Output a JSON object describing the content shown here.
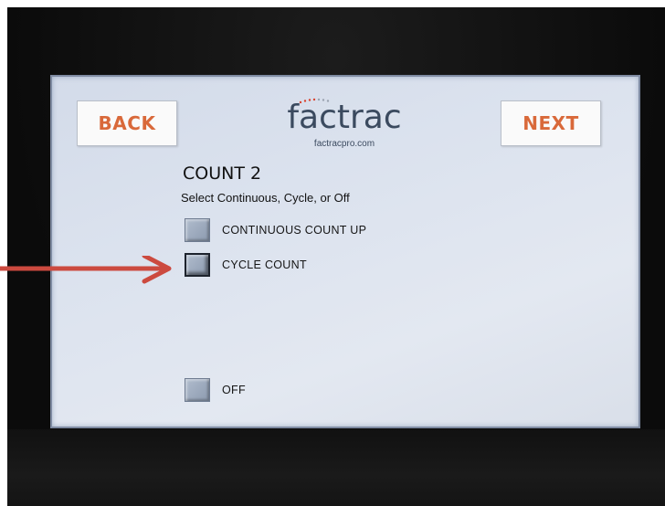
{
  "header": {
    "back_label": "BACK",
    "next_label": "NEXT",
    "logo_text": "factrac",
    "logo_url": "factracpro.com"
  },
  "main": {
    "title": "COUNT 2",
    "subtitle": "Select Continuous, Cycle, or Off",
    "options": [
      {
        "label": "CONTINUOUS COUNT UP",
        "selected": false
      },
      {
        "label": "CYCLE COUNT",
        "selected": true
      },
      {
        "label": "OFF",
        "selected": false
      }
    ]
  },
  "annotation": {
    "arrow_color": "#cc4a3f",
    "target": "CYCLE COUNT"
  },
  "colors": {
    "button_text": "#d9693a",
    "logo": "#3b4a5f",
    "logo_dots": "#d9432f",
    "screen_bg": "#dbe2ee"
  }
}
